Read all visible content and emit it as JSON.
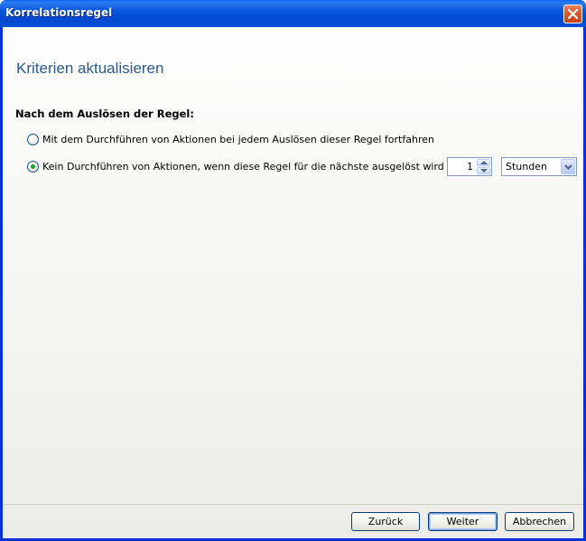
{
  "window": {
    "title": "Korrelationsregel",
    "close_icon": "close-x-icon"
  },
  "page": {
    "title": "Kriterien aktualisieren",
    "section_heading": "Nach dem Auslösen der Regel:"
  },
  "options": [
    {
      "label": "Mit dem Durchführen von Aktionen bei jedem Auslösen dieser Regel fortfahren",
      "checked": false
    },
    {
      "label": "Kein Durchführen von Aktionen, wenn diese Regel für die nächste ausgelöst wird",
      "checked": true
    }
  ],
  "spinner": {
    "value": "1"
  },
  "unit_select": {
    "selected": "Stunden"
  },
  "buttons": {
    "back": "Zurück",
    "next": "Weiter",
    "cancel": "Abbrechen"
  },
  "colors": {
    "titlebar": "#0a57dc",
    "page_title": "#2c5a8a",
    "radio_dot": "#21a121",
    "close_button": "#d9572c"
  }
}
